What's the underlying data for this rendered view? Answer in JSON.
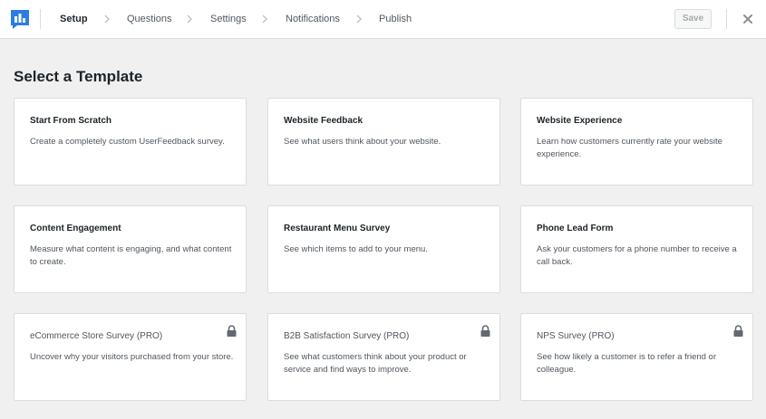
{
  "header": {
    "steps": [
      {
        "label": "Setup"
      },
      {
        "label": "Questions"
      },
      {
        "label": "Settings"
      },
      {
        "label": "Notifications"
      },
      {
        "label": "Publish"
      }
    ],
    "active_step": "Setup",
    "save_label": "Save",
    "icons": {
      "logo": "userfeedback-logo-icon",
      "chevron": "chevron-right-icon",
      "close": "close-icon"
    }
  },
  "main": {
    "title": "Select a Template",
    "templates": [
      {
        "title": "Start From Scratch",
        "description": "Create a completely custom UserFeedback survey.",
        "locked": false
      },
      {
        "title": "Website Feedback",
        "description": "See what users think about your website.",
        "locked": false
      },
      {
        "title": "Website Experience",
        "description": "Learn how customers currently rate your website experience.",
        "locked": false
      },
      {
        "title": "Content Engagement",
        "description": "Measure what content is engaging, and what content to create.",
        "locked": false
      },
      {
        "title": "Restaurant Menu Survey",
        "description": "See which items to add to your menu.",
        "locked": false
      },
      {
        "title": "Phone Lead Form",
        "description": "Ask your customers for a phone number to receive a call back.",
        "locked": false
      },
      {
        "title": "eCommerce Store Survey (PRO)",
        "description": "Uncover why your visitors purchased from your store.",
        "locked": true
      },
      {
        "title": "B2B Satisfaction Survey (PRO)",
        "description": "See what customers think about your product or service and find ways to improve.",
        "locked": true
      },
      {
        "title": "NPS Survey (PRO)",
        "description": "See how likely a customer is to refer a friend or colleague.",
        "locked": true
      }
    ]
  },
  "colors": {
    "brand": "#2d7be5",
    "background": "#f0f0f1",
    "card": "#ffffff"
  }
}
